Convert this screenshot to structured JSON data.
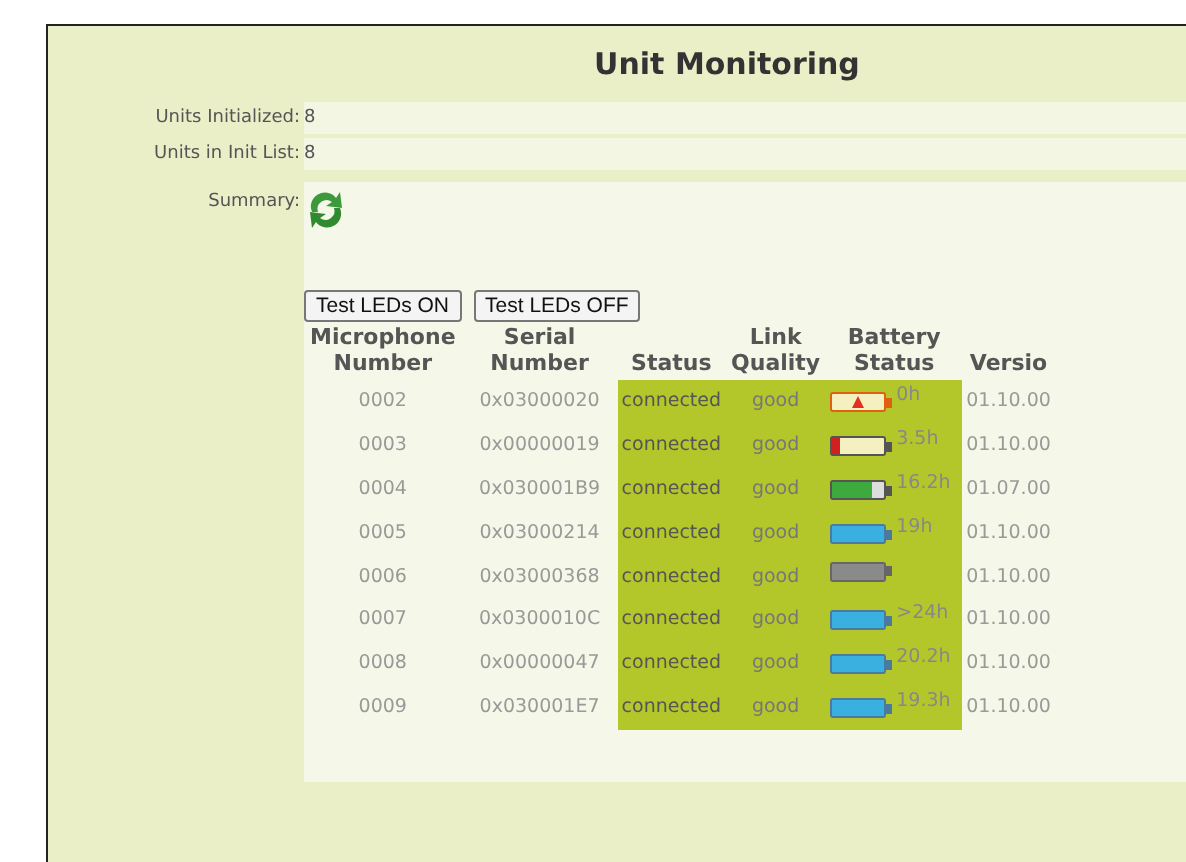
{
  "title": "Unit Monitoring",
  "fields": [
    {
      "label": "Units Initialized:",
      "value": "8"
    },
    {
      "label": "Units in Init List:",
      "value": "8"
    }
  ],
  "summary": {
    "label": "Summary:"
  },
  "buttons": [
    "Test LEDs ON",
    "Test LEDs OFF"
  ],
  "table": {
    "columns": [
      "Microphone Number",
      "Serial Number",
      "Status",
      "Link Quality",
      "Battery Status",
      "Versio"
    ],
    "rows": [
      {
        "number": "0002",
        "serial": "0x03000020",
        "status": "connected",
        "link": "good",
        "battery": {
          "kind": "alert",
          "level": 0
        },
        "hours": "0h",
        "version": "01.10.00"
      },
      {
        "number": "0003",
        "serial": "0x00000019",
        "status": "connected",
        "link": "good",
        "battery": {
          "kind": "low",
          "level": 0.15
        },
        "hours": "3.5h",
        "version": "01.10.00"
      },
      {
        "number": "0004",
        "serial": "0x030001B9",
        "status": "connected",
        "link": "good",
        "battery": {
          "kind": "mid",
          "level": 0.75
        },
        "hours": "16.2h",
        "version": "01.07.00"
      },
      {
        "number": "0005",
        "serial": "0x03000214",
        "status": "connected",
        "link": "good",
        "battery": {
          "kind": "full",
          "level": 1
        },
        "hours": "19h",
        "version": "01.10.00"
      },
      {
        "number": "0006",
        "serial": "0x03000368",
        "status": "connected",
        "link": "good",
        "battery": {
          "kind": "unknown",
          "level": 1
        },
        "version": "01.10.00"
      },
      {
        "number": "0007",
        "serial": "0x0300010C",
        "status": "connected",
        "link": "good",
        "battery": {
          "kind": "full",
          "level": 1
        },
        "hours": ">24h",
        "version": "01.10.00"
      },
      {
        "number": "0008",
        "serial": "0x00000047",
        "status": "connected",
        "link": "good",
        "battery": {
          "kind": "full",
          "level": 1
        },
        "hours": "20.2h",
        "version": "01.10.00"
      },
      {
        "number": "0009",
        "serial": "0x030001E7",
        "status": "connected",
        "link": "good",
        "battery": {
          "kind": "full",
          "level": 1
        },
        "hours": "19.3h",
        "version": "01.10.00"
      }
    ]
  }
}
